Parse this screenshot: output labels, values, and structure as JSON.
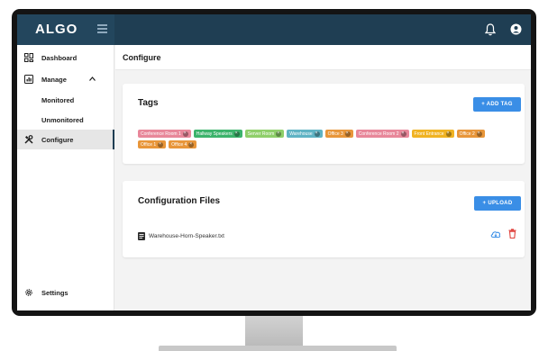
{
  "brand": {
    "logo_text": "ALGO"
  },
  "header": {
    "title": "Configure"
  },
  "sidebar": {
    "items": [
      {
        "label": "Dashboard"
      },
      {
        "label": "Manage"
      },
      {
        "label": "Monitored"
      },
      {
        "label": "Unmonitored"
      },
      {
        "label": "Configure"
      },
      {
        "label": "Settings"
      }
    ]
  },
  "tags_card": {
    "title": "Tags",
    "add_button": "+ ADD TAG",
    "tags": [
      {
        "label": "Conference Room 1",
        "color": "#e8879a"
      },
      {
        "label": "Hallway Speakers",
        "color": "#3bb36b"
      },
      {
        "label": "Server Room",
        "color": "#8fcf6a"
      },
      {
        "label": "Warehouse",
        "color": "#5fb3c4"
      },
      {
        "label": "Office 3",
        "color": "#e8963a"
      },
      {
        "label": "Conference Room 2",
        "color": "#e8879a"
      },
      {
        "label": "Front Entrance",
        "color": "#f0b323"
      },
      {
        "label": "Office 2",
        "color": "#e8963a"
      },
      {
        "label": "Office 1",
        "color": "#e8963a"
      },
      {
        "label": "Office 4",
        "color": "#e8963a"
      }
    ]
  },
  "files_card": {
    "title": "Configuration Files",
    "upload_button": "+ UPLOAD",
    "files": [
      {
        "name": "Warehouse-Horn-Speaker.txt"
      }
    ]
  },
  "colors": {
    "topbar": "#1f3e53",
    "accent": "#3a8ee6",
    "delete": "#e0413b"
  }
}
